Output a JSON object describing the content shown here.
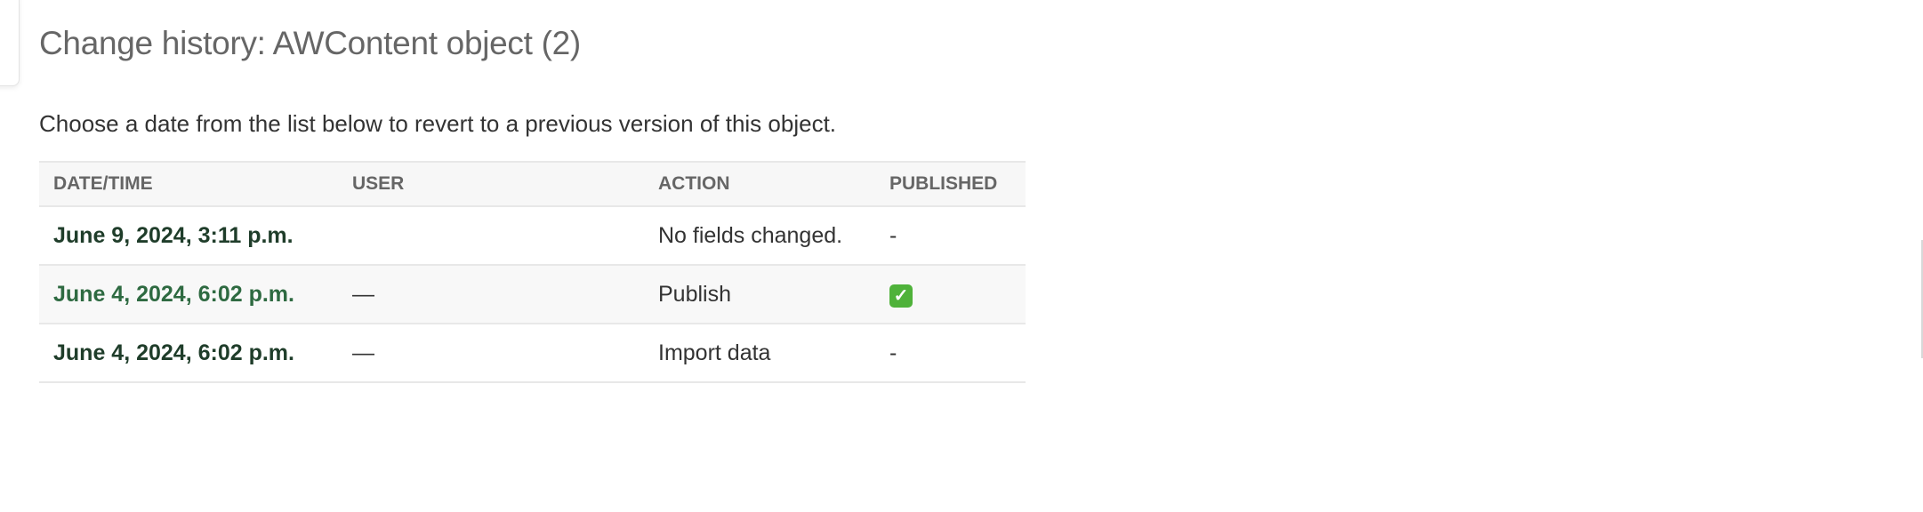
{
  "page": {
    "title": "Change history: AWContent object (2)",
    "intro": "Choose a date from the list below to revert to a previous version of this object."
  },
  "table": {
    "headers": [
      "Date/time",
      "User",
      "Action",
      "Published"
    ],
    "rows": [
      {
        "date": "June 9, 2024, 3:11 p.m.",
        "user": "",
        "action": "No fields changed.",
        "published": "-"
      },
      {
        "date": "June 4, 2024, 6:02 p.m.",
        "user": "—",
        "action": "Publish",
        "published": "✓",
        "published_icon": "check-mark-button-icon"
      },
      {
        "date": "June 4, 2024, 6:02 p.m.",
        "user": "—",
        "action": "Import data",
        "published": "-"
      }
    ]
  },
  "colors": {
    "link": "#1f3d2a",
    "link_hover": "#2e6a41",
    "check": "#4fb23a"
  }
}
